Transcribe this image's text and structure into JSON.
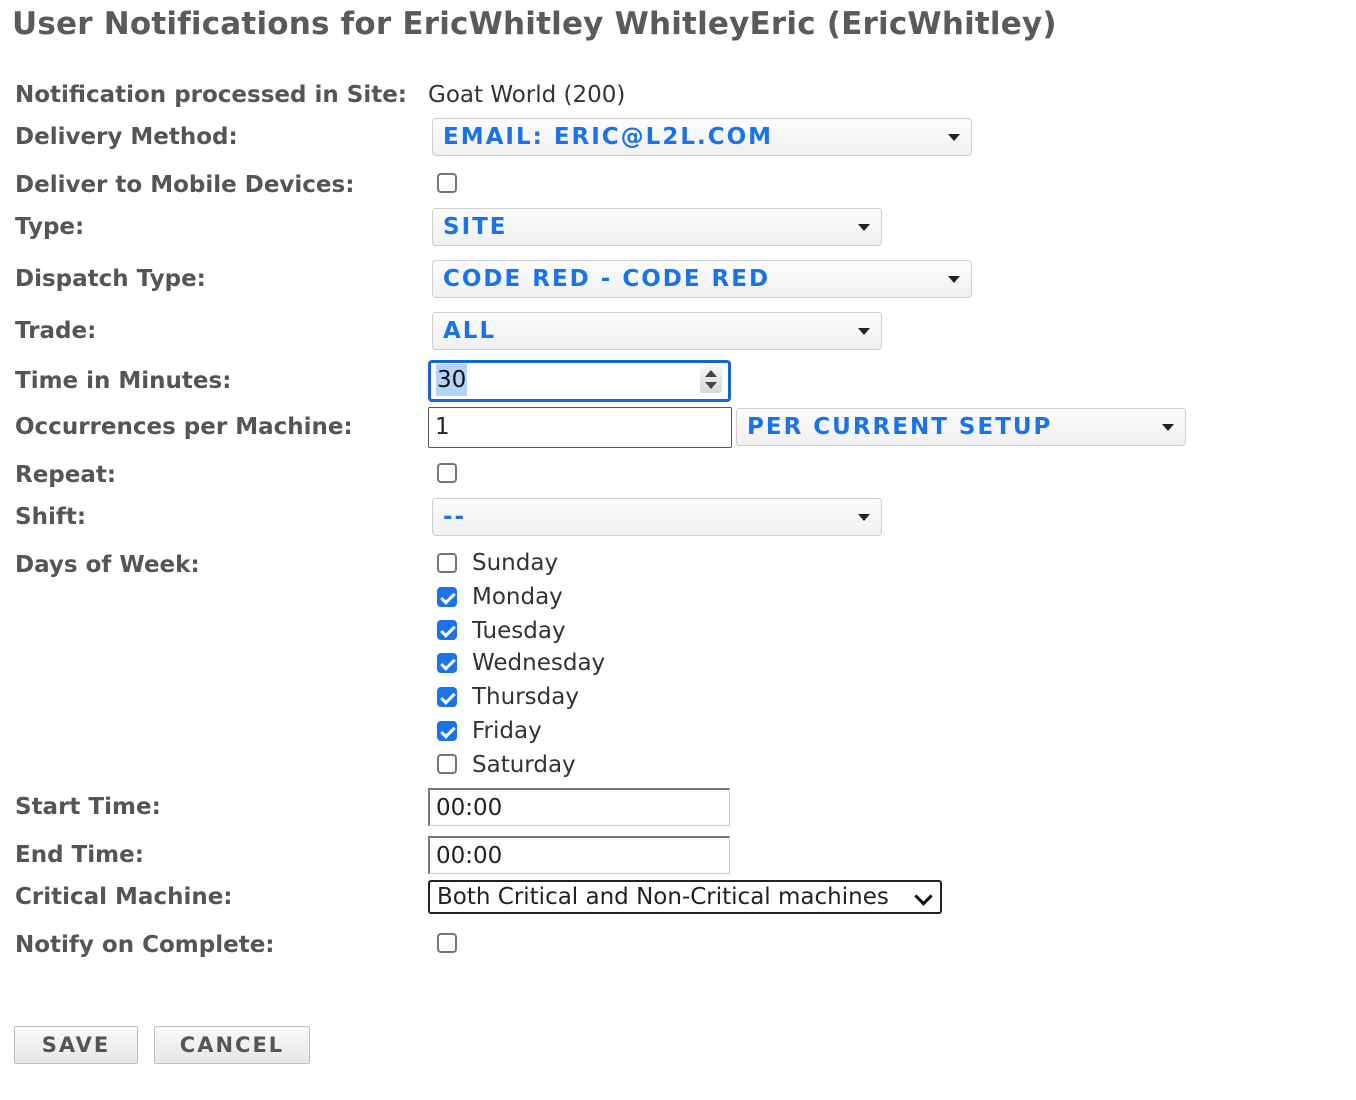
{
  "page": {
    "title": "User Notifications for EricWhitley WhitleyEric (EricWhitley)"
  },
  "site": {
    "label": "Notification processed in Site:",
    "value": "Goat World (200)"
  },
  "delivery_method": {
    "label": "Delivery Method:",
    "value": "EMAIL: ERIC@L2L.COM"
  },
  "mobile": {
    "label": "Deliver to Mobile Devices:",
    "checked": false
  },
  "type": {
    "label": "Type:",
    "value": "SITE"
  },
  "dispatch_type": {
    "label": "Dispatch Type:",
    "value": "CODE RED - CODE RED"
  },
  "trade": {
    "label": "Trade:",
    "value": "ALL"
  },
  "time_minutes": {
    "label": "Time in Minutes:",
    "value": "30"
  },
  "occurrences": {
    "label": "Occurrences per Machine:",
    "value": "1",
    "mode": "PER CURRENT SETUP"
  },
  "repeat": {
    "label": "Repeat:",
    "checked": false
  },
  "shift": {
    "label": "Shift:",
    "value": "--"
  },
  "days": {
    "label": "Days of Week:",
    "items": [
      {
        "name": "Sunday",
        "checked": false
      },
      {
        "name": "Monday",
        "checked": true
      },
      {
        "name": "Tuesday",
        "checked": true
      },
      {
        "name": "Wednesday",
        "checked": true
      },
      {
        "name": "Thursday",
        "checked": true
      },
      {
        "name": "Friday",
        "checked": true
      },
      {
        "name": "Saturday",
        "checked": false
      }
    ]
  },
  "start_time": {
    "label": "Start Time:",
    "value": "00:00"
  },
  "end_time": {
    "label": "End Time:",
    "value": "00:00"
  },
  "critical": {
    "label": "Critical Machine:",
    "value": "Both Critical and Non-Critical machines"
  },
  "notify_complete": {
    "label": "Notify on Complete:",
    "checked": false
  },
  "buttons": {
    "save": "SAVE",
    "cancel": "CANCEL"
  },
  "colors": {
    "accent": "#1a73e8",
    "label": "#555555",
    "title": "#5a5a5a"
  }
}
